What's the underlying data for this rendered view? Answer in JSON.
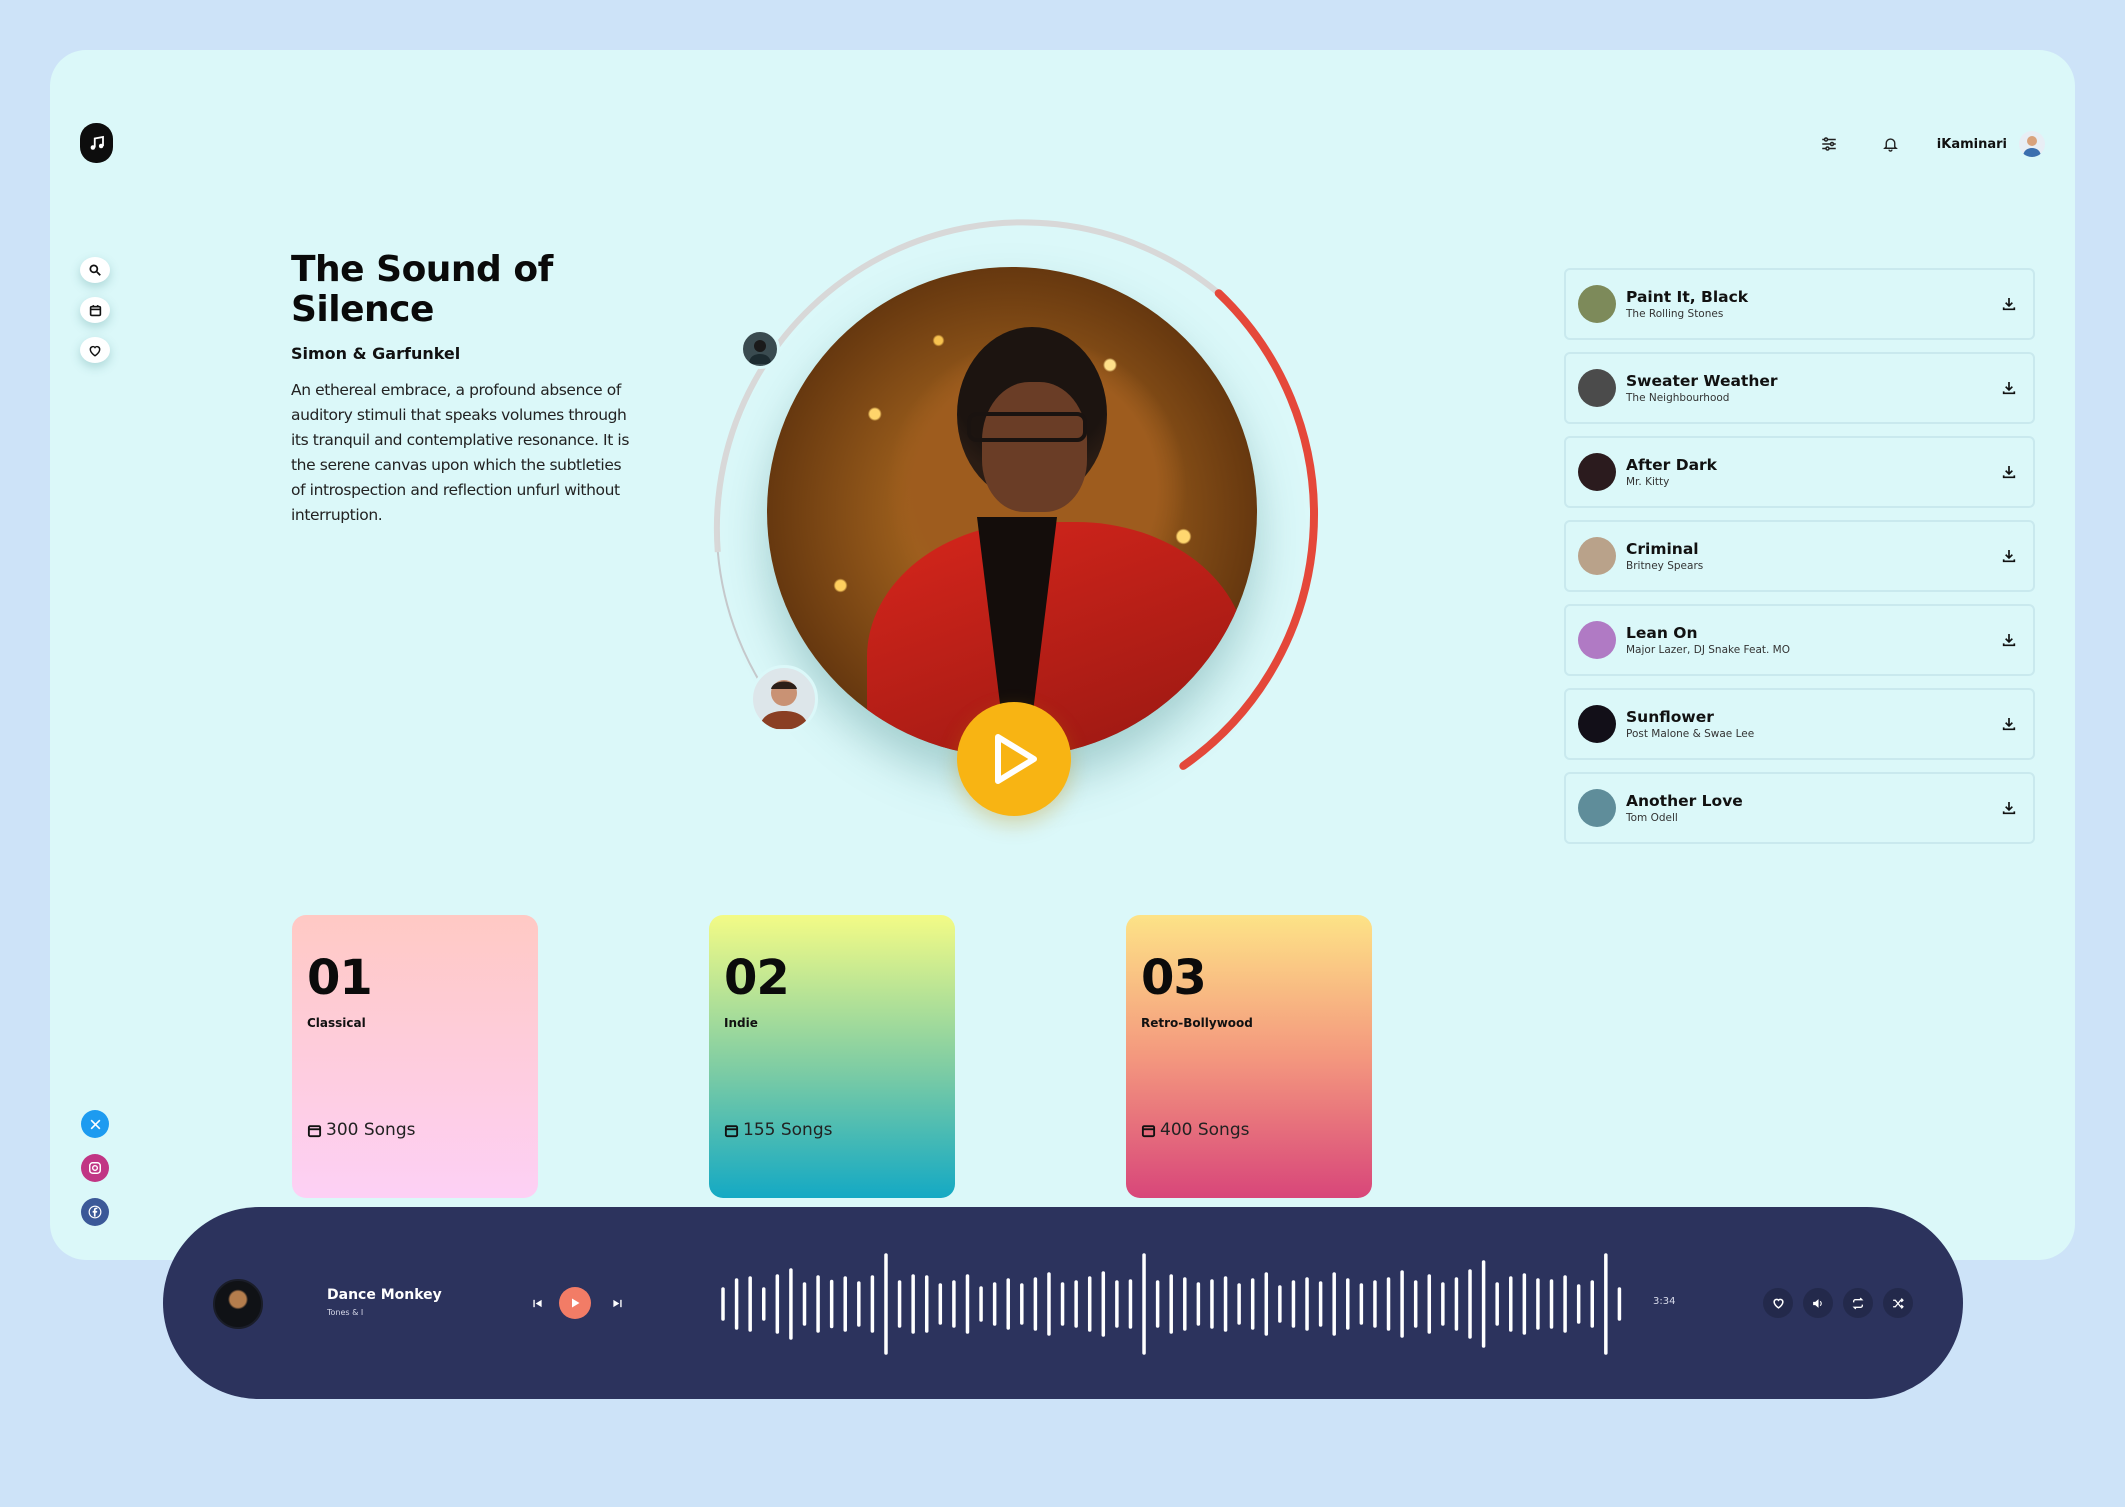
{
  "app": {
    "logo_icon": "music-note-icon"
  },
  "header": {
    "username": "iKaminari",
    "icons": [
      "sliders-icon",
      "bell-icon",
      "avatar"
    ]
  },
  "side_nav": [
    "search-icon",
    "calendar-icon",
    "heart-icon"
  ],
  "social": [
    {
      "name": "x-icon",
      "color": "#1d9bf0",
      "glyph": "X"
    },
    {
      "name": "instagram-icon",
      "color": "#c13584",
      "glyph": "◎"
    },
    {
      "name": "facebook-icon",
      "color": "#3b5998",
      "glyph": "f"
    }
  ],
  "hero": {
    "title": "The Sound of Silence",
    "artist": "Simon & Garfunkel",
    "description": "An ethereal embrace, a profound absence of auditory stimuli that speaks volumes through its tranquil and contemplative resonance. It is the serene canvas upon which the subtleties of introspection and reflection unfurl without interruption.",
    "accent_red": "#e5483a",
    "play_color": "#f8b413"
  },
  "tracks": [
    {
      "title": "Paint It, Black",
      "artist": "The Rolling Stones",
      "thumb": "#7d8a5a"
    },
    {
      "title": "Sweater Weather",
      "artist": "The Neighbourhood",
      "thumb": "#4b4b4b"
    },
    {
      "title": "After Dark",
      "artist": "Mr. Kitty",
      "thumb": "#2b1b1e"
    },
    {
      "title": "Criminal",
      "artist": "Britney Spears",
      "thumb": "#b9a28a"
    },
    {
      "title": "Lean On",
      "artist": "Major Lazer, DJ Snake Feat. MO",
      "thumb": "#b07ac4"
    },
    {
      "title": "Sunflower",
      "artist": "Post Malone & Swae Lee",
      "thumb": "#120f18"
    },
    {
      "title": "Another Love",
      "artist": "Tom Odell",
      "thumb": "#5f8d9a"
    }
  ],
  "genres": [
    {
      "num": "01",
      "name": "Classical",
      "songs": "300 Songs"
    },
    {
      "num": "02",
      "name": "Indie",
      "songs": "155 Songs"
    },
    {
      "num": "03",
      "name": "Retro-Bollywood",
      "songs": "400 Songs"
    }
  ],
  "player": {
    "title": "Dance Monkey",
    "artist": "Tones & I",
    "time": "3:34",
    "controls": [
      "previous-icon",
      "play-icon",
      "next-icon"
    ],
    "actions": [
      "heart-icon",
      "volume-icon",
      "repeat-icon",
      "shuffle-icon"
    ],
    "accent": "#f27c66",
    "background": "#2c335d",
    "waveform": [
      30,
      48,
      52,
      30,
      56,
      68,
      40,
      54,
      45,
      52,
      42,
      54,
      98,
      44,
      56,
      54,
      38,
      44,
      56,
      32,
      40,
      48,
      38,
      50,
      60,
      40,
      44,
      52,
      62,
      44,
      46,
      98,
      44,
      56,
      50,
      40,
      46,
      52,
      38,
      48,
      60,
      34,
      44,
      50,
      42,
      60,
      48,
      38,
      44,
      50,
      64,
      44,
      56,
      40,
      50,
      66,
      84,
      40,
      52,
      58,
      48,
      46,
      54,
      36,
      44,
      98,
      30
    ]
  }
}
